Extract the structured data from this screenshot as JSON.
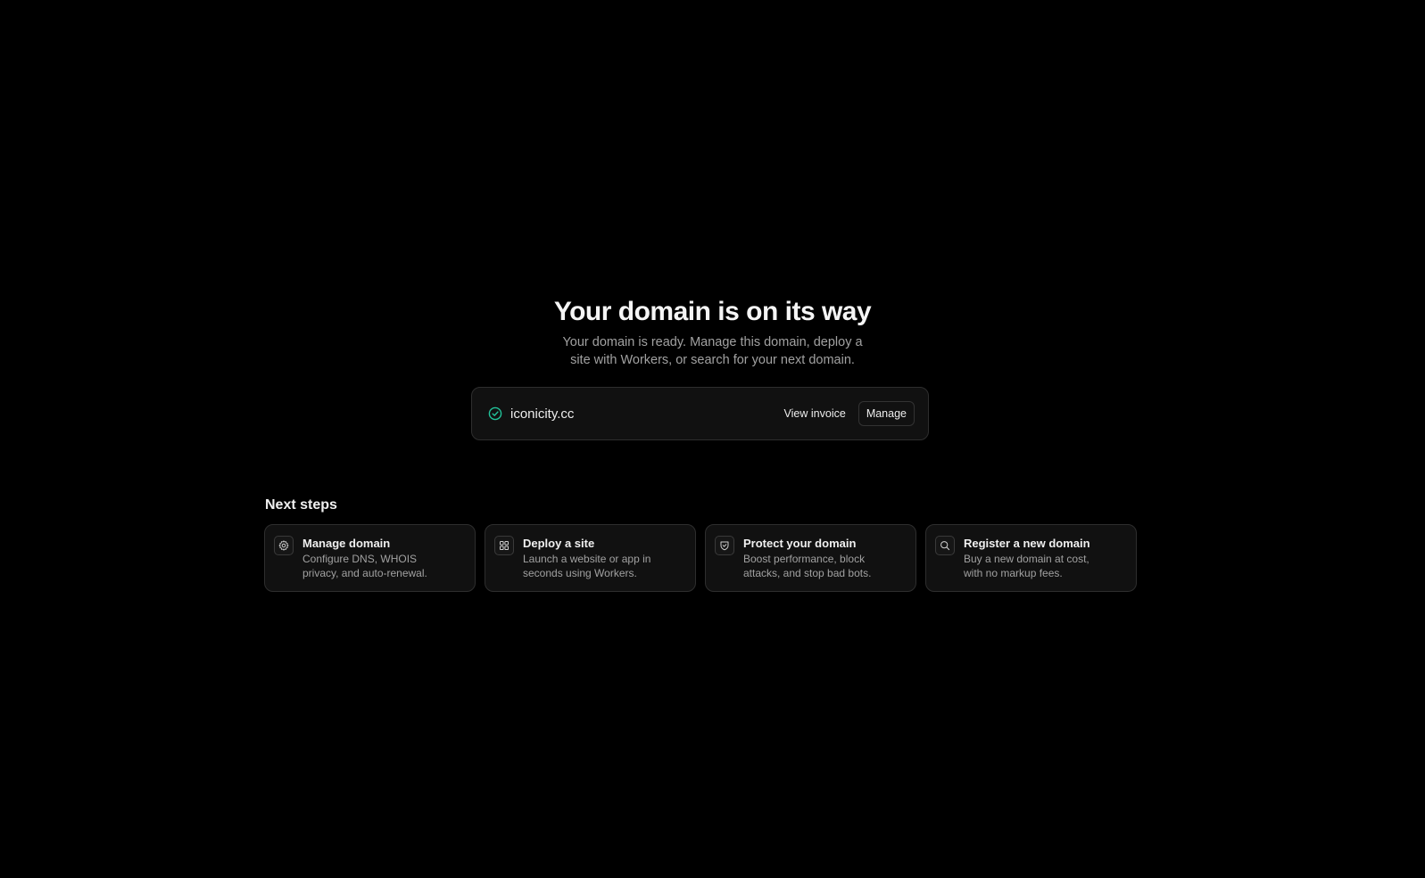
{
  "hero": {
    "title": "Your domain is on its way",
    "subtitle": "Your domain is ready. Manage this domain, deploy a site with Workers, or search for your next domain."
  },
  "domain": {
    "name": "iconicity.cc",
    "status_icon": "check-circle-icon",
    "status_color": "#22c39a",
    "view_invoice_label": "View invoice",
    "manage_label": "Manage"
  },
  "next_steps": {
    "title": "Next steps",
    "items": [
      {
        "icon": "gear-icon",
        "title": "Manage domain",
        "description": "Configure DNS, WHOIS privacy, and auto-renewal."
      },
      {
        "icon": "grid-icon",
        "title": "Deploy a site",
        "description": "Launch a website or app in seconds using Workers."
      },
      {
        "icon": "shield-icon",
        "title": "Protect your domain",
        "description": "Boost performance, block attacks, and stop bad bots."
      },
      {
        "icon": "search-icon",
        "title": "Register a new domain",
        "description": "Buy a new domain at cost, with no markup fees."
      }
    ]
  },
  "colors": {
    "background": "#000000",
    "card": "#111111",
    "border": "#2e2e2e",
    "muted_text": "#a1a1a1"
  }
}
